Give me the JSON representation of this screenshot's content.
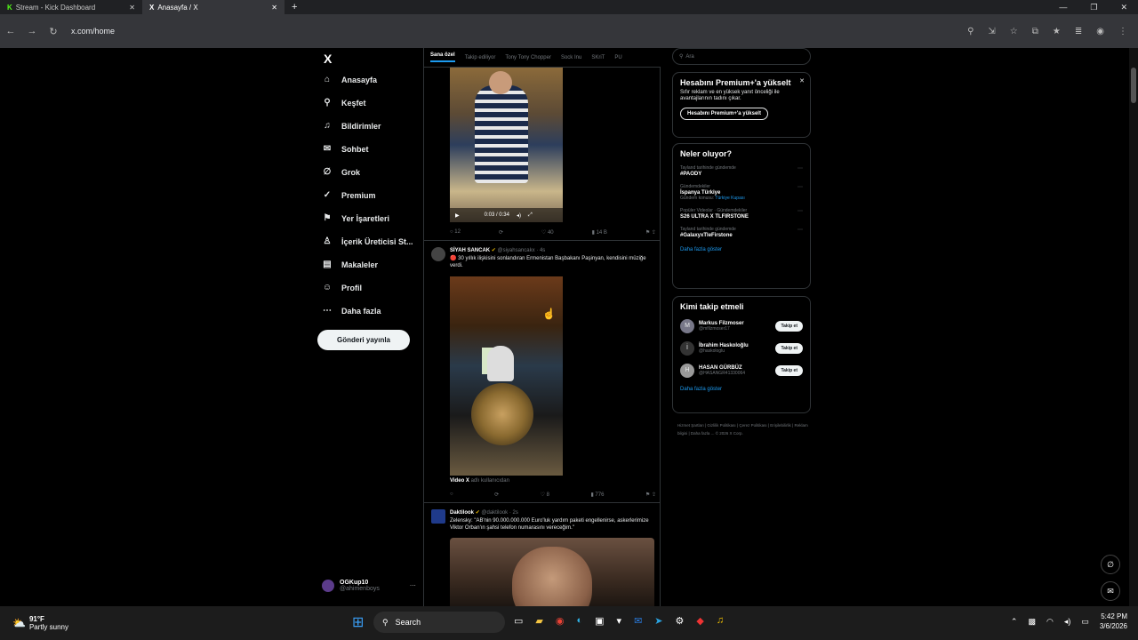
{
  "browser": {
    "tabs": [
      {
        "title": "Stream - Kick Dashboard"
      },
      {
        "title": "Anasayfa / X"
      }
    ],
    "url": "x.com/home"
  },
  "sidebar": {
    "logo": "X",
    "items": [
      {
        "label": "Anasayfa",
        "icon": "⌂"
      },
      {
        "label": "Keşfet",
        "icon": "⚲"
      },
      {
        "label": "Bildirimler",
        "icon": "♫"
      },
      {
        "label": "Sohbet",
        "icon": "✉"
      },
      {
        "label": "Grok",
        "icon": "∅"
      },
      {
        "label": "Premium",
        "icon": "✓"
      },
      {
        "label": "Yer İşaretleri",
        "icon": "⚑"
      },
      {
        "label": "İçerik Üreticisi St...",
        "icon": "♙"
      },
      {
        "label": "Makaleler",
        "icon": "▤"
      },
      {
        "label": "Profil",
        "icon": "☺"
      },
      {
        "label": "Daha fazla",
        "icon": "⋯"
      }
    ],
    "post_button": "Gönderi yayınla",
    "account": {
      "name": "OGKup10",
      "handle": "@ahimenboys"
    }
  },
  "feed": {
    "tabs": [
      "Sana özel",
      "Takip ediliyor",
      "Tony Tony Chopper",
      "Sock Inu",
      "SKriT",
      "PU"
    ],
    "video1": {
      "time": "0:03 / 0:34"
    },
    "actions1": {
      "replies": "12",
      "reposts": "",
      "likes": "40",
      "views": "14 B"
    },
    "tweet2": {
      "name": "SİYAH SANCAK",
      "handle": "@siyahsancakx",
      "time": "4s",
      "text": "🔴 30 yıllık ilişkisini sonlandıran Ermenistan Başbakanı Paşinyan, kendisini müziğe verdi.",
      "video_source": "Video X",
      "video_source_rest": "adlı kullanıcıdan"
    },
    "actions2": {
      "replies": "",
      "reposts": "",
      "likes": "8",
      "views": "776"
    },
    "tweet3": {
      "name": "Daktilook",
      "handle": "@daktilook",
      "time": "2s",
      "text": "Zelensky: \"AB'nin 90.000.000.000 Euro'luk yardım paketi engellenirse, askerlerimize Viktor Orban'ın şahsi telefon numarasını vereceğim.\""
    }
  },
  "right": {
    "search_placeholder": "Ara",
    "premium": {
      "title": "Hesabını Premium+'a yükselt",
      "text": "Sıfır reklam ve en yüksek yanıt önceliği ile avantajlarının tadını çıkar.",
      "button": "Hesabını Premium+'a yükselt"
    },
    "trends": {
      "title": "Neler oluyor?",
      "items": [
        {
          "context": "Tayland tarihinde gündemde",
          "title": "#PAODY",
          "extra": "",
          "topic": ""
        },
        {
          "context": "Gündemdekiler",
          "title": "İspanya Türkiye",
          "extra": "Gündem konusu:",
          "topic": "Türkiye Kupası"
        },
        {
          "context": "Popüler Videolar · Gündemdekiler",
          "title": "S26 ULTRA X TLFIRSTONE",
          "extra": "",
          "topic": ""
        },
        {
          "context": "Tayland tarihinde gündemde",
          "title": "#GalaxyxTleFirstone",
          "extra": "",
          "topic": ""
        }
      ],
      "more": "Daha fazla göster"
    },
    "who_to_follow": {
      "title": "Kimi takip etmeli",
      "users": [
        {
          "name": "Markus Filzmoser",
          "handle": "@mfilzmoser17",
          "initial": "M"
        },
        {
          "name": "İbrahim Haskoloğlu",
          "handle": "@haskologlu",
          "initial": "İ"
        },
        {
          "name": "HASAN GÜRBÜZ",
          "handle": "@HASANGR41330064",
          "initial": "H"
        }
      ],
      "button": "Takip et",
      "more": "Daha fazla göster"
    },
    "footer": "Hizmet Şartları | Gizlilik Politikası | Çerez Politikası | Erişilebilirlik | Reklam bilgisi | Daha fazla ... © 2026 X Corp."
  },
  "taskbar": {
    "weather_temp": "91°F",
    "weather_text": "Partly sunny",
    "search": "Search",
    "time": "5:42 PM",
    "date": "3/6/2026"
  }
}
